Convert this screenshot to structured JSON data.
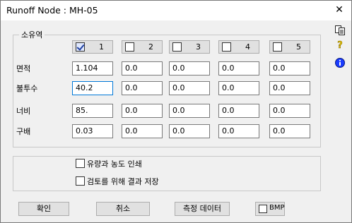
{
  "window": {
    "title": "Runoff Node : MH-05",
    "close_glyph": "✕"
  },
  "side_icons": [
    "copy-icon",
    "help-icon",
    "info-icon"
  ],
  "group_subbasin": {
    "label": "소유역",
    "columns": [
      {
        "label": "1",
        "checked": true
      },
      {
        "label": "2",
        "checked": false
      },
      {
        "label": "3",
        "checked": false
      },
      {
        "label": "4",
        "checked": false
      },
      {
        "label": "5",
        "checked": false
      }
    ],
    "rows": [
      {
        "label": "면적",
        "values": [
          "1.104",
          "0.0",
          "0.0",
          "0.0",
          "0.0"
        ]
      },
      {
        "label": "불투수",
        "values": [
          "40.2",
          "0.0",
          "0.0",
          "0.0",
          "0.0"
        ]
      },
      {
        "label": "너비",
        "values": [
          "85.",
          "0.0",
          "0.0",
          "0.0",
          "0.0"
        ]
      },
      {
        "label": "구배",
        "values": [
          "0.03",
          "0.0",
          "0.0",
          "0.0",
          "0.0"
        ]
      }
    ]
  },
  "options": {
    "print_label": "유량과 농도 인쇄",
    "save_label": "검토를 위해 결과 저장"
  },
  "buttons": {
    "ok": "확인",
    "cancel": "취소",
    "measured": "측정 데이터",
    "bmp": "BMP"
  }
}
